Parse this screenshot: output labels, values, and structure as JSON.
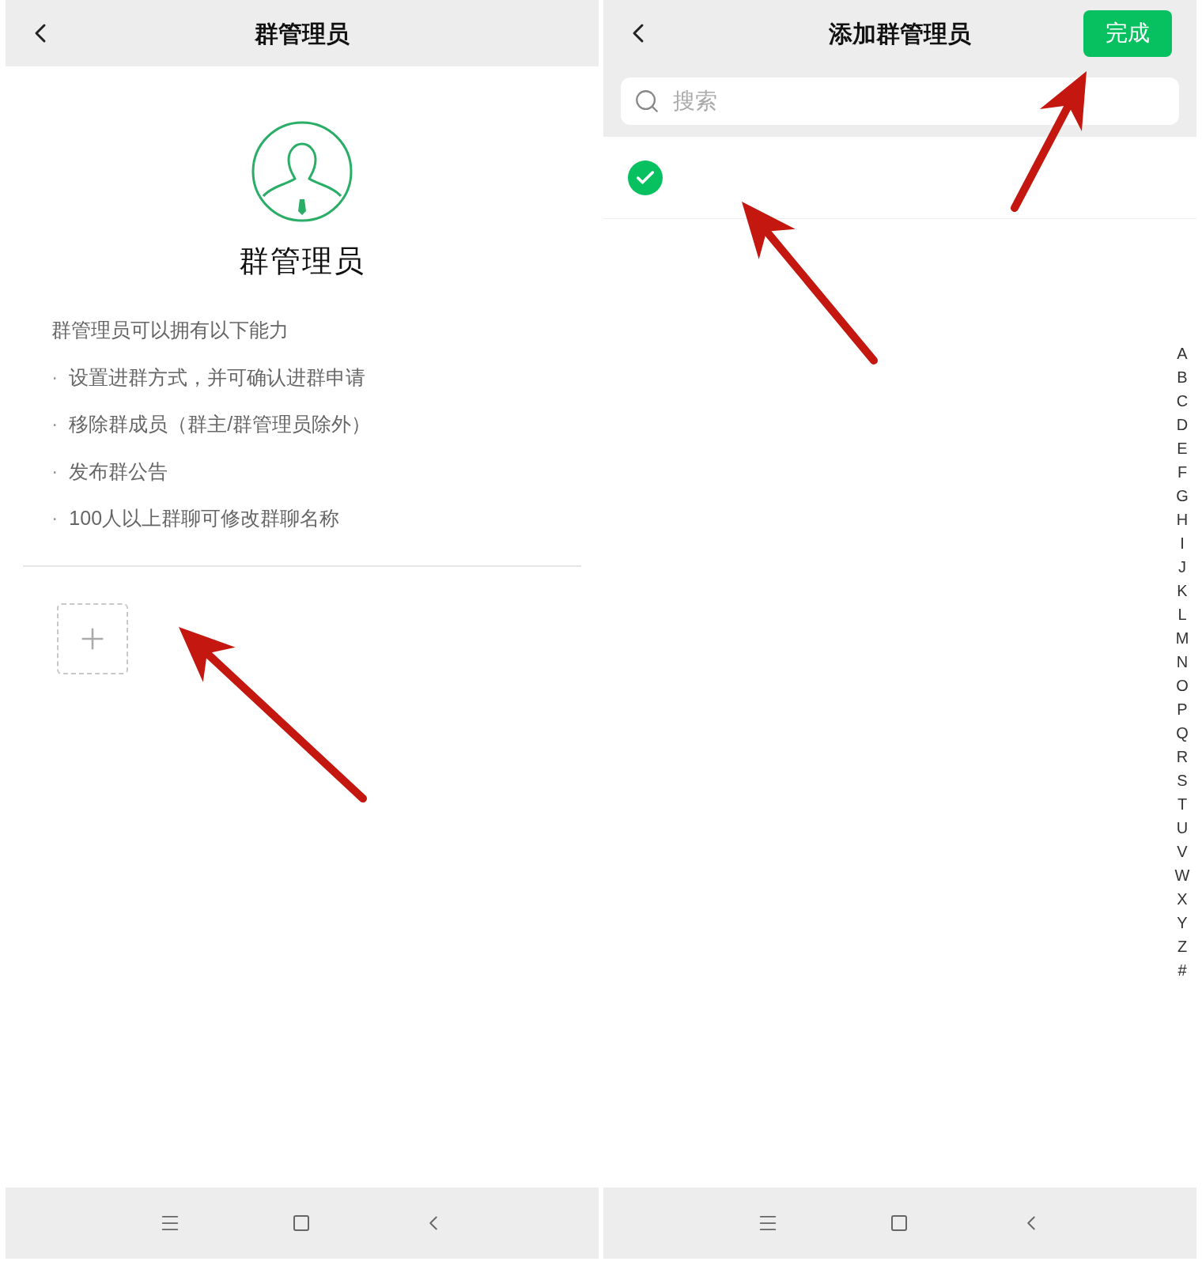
{
  "left_screen": {
    "header": {
      "title": "群管理员"
    },
    "hero_title": "群管理员",
    "intro": "群管理员可以拥有以下能力",
    "abilities": [
      {
        "bullet": "·",
        "text": "设置进群方式，并可确认进群申请"
      },
      {
        "bullet": "·",
        "text": "移除群成员（群主/群管理员除外）"
      },
      {
        "bullet": "·",
        "text": "发布群公告"
      },
      {
        "bullet": "·",
        "text": "100人以上群聊可修改群聊名称"
      }
    ]
  },
  "right_screen": {
    "header": {
      "title": "添加群管理员",
      "done_button": "完成"
    },
    "search": {
      "placeholder": "搜索"
    },
    "members": [
      {
        "selected": true
      }
    ],
    "index_letters": [
      "A",
      "B",
      "C",
      "D",
      "E",
      "F",
      "G",
      "H",
      "I",
      "J",
      "K",
      "L",
      "M",
      "N",
      "O",
      "P",
      "Q",
      "R",
      "S",
      "T",
      "U",
      "V",
      "W",
      "X",
      "Y",
      "Z",
      "#"
    ]
  }
}
